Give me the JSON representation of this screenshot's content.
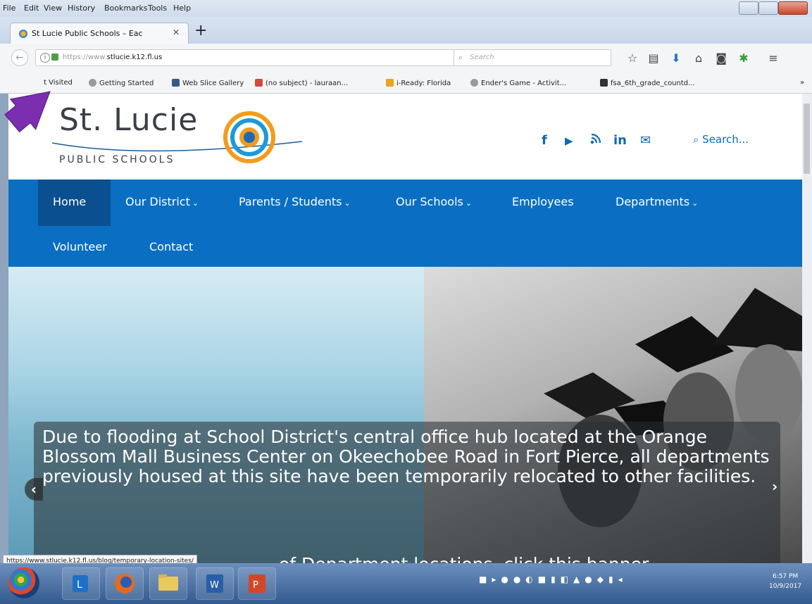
{
  "menubar": [
    "File",
    "Edit",
    "View",
    "History",
    "Bookmarks",
    "Tools",
    "Help"
  ],
  "tab": {
    "title": "St Lucie Public Schools – Eac",
    "close": "✕",
    "new_tab": "+"
  },
  "urlbar": {
    "scheme": "https://www.",
    "host": "stlucie.k12.fl.us",
    "reload": "C"
  },
  "searchbar": {
    "placeholder": "Search"
  },
  "bookmarks": [
    "t Visited",
    "Getting Started",
    "Web Slice Gallery",
    "(no subject) - lauraan...",
    "i-Ready: Florida",
    "Ender's Game - Activit...",
    "fsa_6th_grade_countd..."
  ],
  "header": {
    "logo_title": "St. Lucie",
    "logo_subtitle": "PUBLIC SCHOOLS",
    "social": [
      "f",
      "▶",
      "rss",
      "in",
      "✉"
    ],
    "search_label": "Search..."
  },
  "nav": {
    "row1": [
      "Home",
      "Our District",
      "Parents / Students",
      "Our Schools",
      "Employees",
      "Departments"
    ],
    "row2": [
      "Volunteer",
      "Contact"
    ]
  },
  "hero": {
    "caption": "Due to flooding at School District's central office hub located at the Orange Blossom Mall Business Center on Okeechobee Road in Fort Pierce, all departments previously housed at this site have been temporarily relocated to other facilities.",
    "caption_sub": "of Department locations, click this banner."
  },
  "statusbar": {
    "link": "https://www.stlucie.k12.fl.us/blog/temporary-location-sites/"
  },
  "taskbar": {
    "time": "6:57 PM",
    "date": "10/9/2017"
  },
  "colors": {
    "nav_blue": "#0a6fc2",
    "home_active": "#0a4f8f",
    "pointer_arrow": "#7b2fb0"
  }
}
